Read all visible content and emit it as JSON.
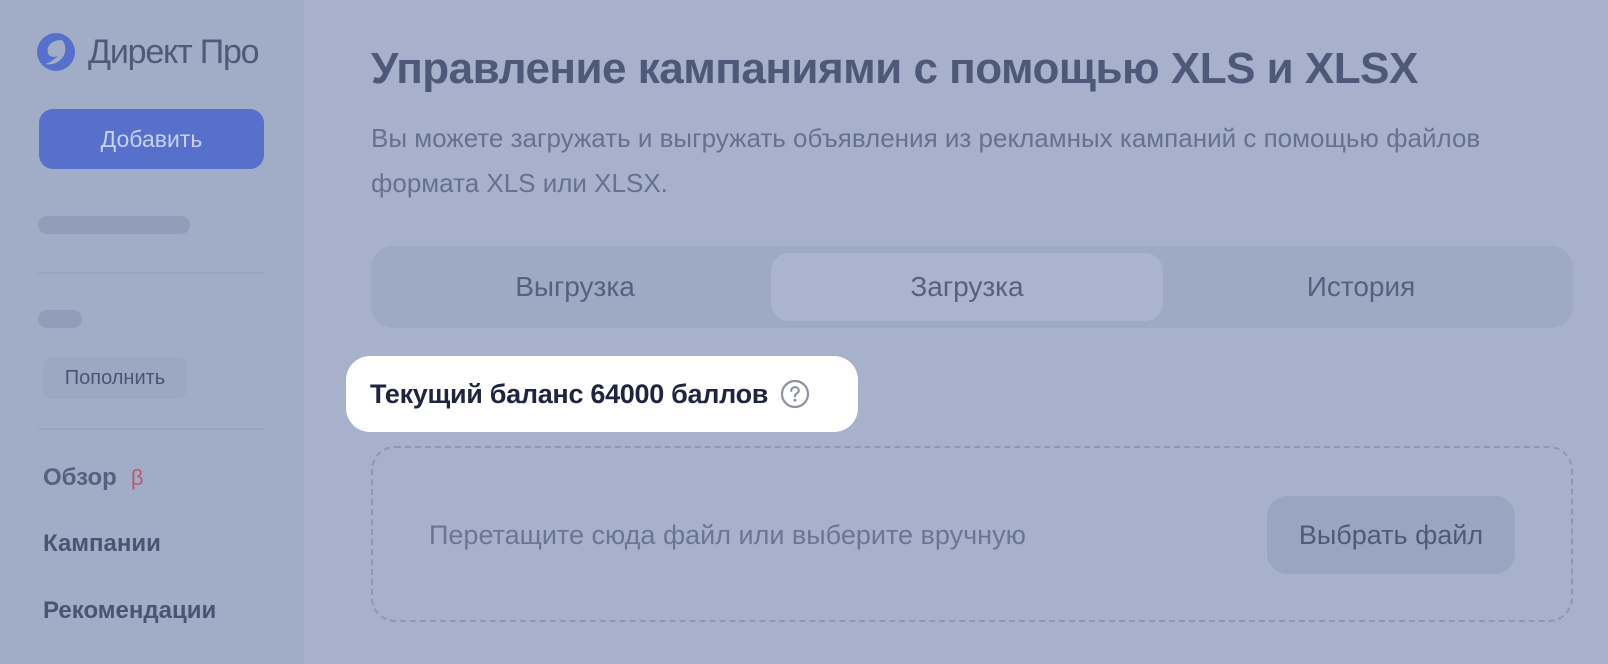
{
  "brand": {
    "name": "Директ Про",
    "logo_icon": "direct-logo-icon"
  },
  "sidebar": {
    "add_button": "Добавить",
    "topup_button": "Пополнить",
    "nav": {
      "overview": "Обзор",
      "overview_badge": "β",
      "campaigns": "Кампании",
      "recommendations": "Рекомендации"
    }
  },
  "main": {
    "title": "Управление кампаниями с помощью XLS и XLSX",
    "description": "Вы можете загружать и выгружать объявления из рекламных кампаний с помощью файлов формата XLS или XLSX.",
    "tabs": [
      {
        "label": "Выгрузка",
        "active": false
      },
      {
        "label": "Загрузка",
        "active": true
      },
      {
        "label": "История",
        "active": false
      }
    ],
    "balance": {
      "text": "Текущий баланс 64000 баллов",
      "help_icon": "question-circle-icon"
    },
    "dropzone": {
      "hint": "Перетащите сюда файл или выберите вручную",
      "choose_button": "Выбрать файл"
    }
  },
  "colors": {
    "accent": "#5770cc",
    "overlay": "#a7b1cb",
    "highlight": "#ffffff",
    "beta": "#b85a70"
  }
}
